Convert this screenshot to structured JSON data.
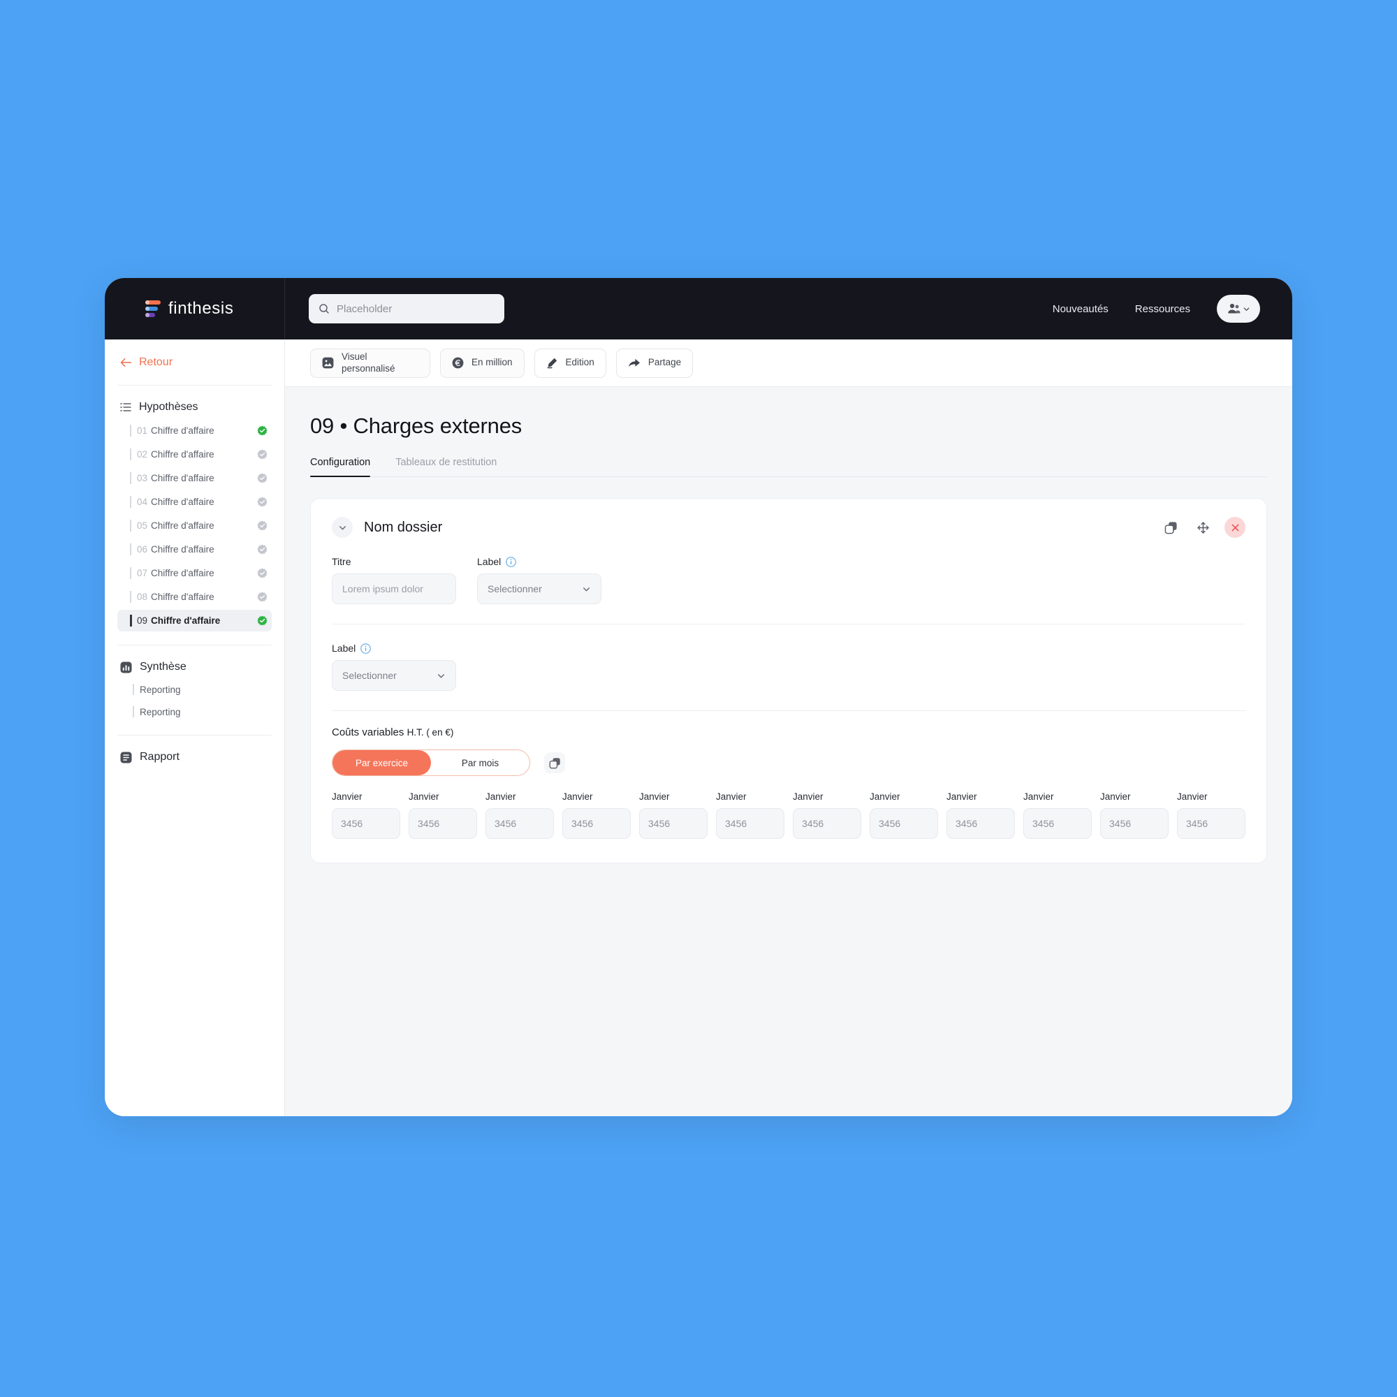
{
  "brand": {
    "name": "finthesis",
    "logo_colors": [
      "#f2714f",
      "#3f8fe0",
      "#6b3fb5"
    ]
  },
  "search": {
    "placeholder": "Placeholder",
    "icon": "search-icon"
  },
  "topnav": {
    "links": [
      {
        "label": "Nouveautés"
      },
      {
        "label": "Ressources"
      }
    ],
    "account": {
      "icon": "users-icon",
      "chevron": "chevron-down-icon"
    }
  },
  "sidebar": {
    "back": {
      "label": "Retour",
      "icon": "arrow-left-icon",
      "color": "#f2714f"
    },
    "sections": [
      {
        "title": "Hypothèses",
        "icon": "list-icon",
        "items": [
          {
            "num": "01",
            "label": "Chiffre d'affaire",
            "status": "done",
            "active": false
          },
          {
            "num": "02",
            "label": "Chiffre d'affaire",
            "status": "pending",
            "active": false
          },
          {
            "num": "03",
            "label": "Chiffre d'affaire",
            "status": "pending",
            "active": false
          },
          {
            "num": "04",
            "label": "Chiffre d'affaire",
            "status": "pending",
            "active": false
          },
          {
            "num": "05",
            "label": "Chiffre d'affaire",
            "status": "pending",
            "active": false
          },
          {
            "num": "06",
            "label": "Chiffre d'affaire",
            "status": "pending",
            "active": false
          },
          {
            "num": "07",
            "label": "Chiffre d'affaire",
            "status": "pending",
            "active": false
          },
          {
            "num": "08",
            "label": "Chiffre d'affaire",
            "status": "pending",
            "active": false
          },
          {
            "num": "09",
            "label": "Chiffre d'affaire",
            "status": "done",
            "active": true
          }
        ]
      },
      {
        "title": "Synthèse",
        "icon": "bar-chart-icon",
        "sub_items": [
          {
            "label": "Reporting"
          },
          {
            "label": "Reporting"
          }
        ]
      },
      {
        "title": "Rapport",
        "icon": "document-icon",
        "sub_items": []
      }
    ],
    "status_colors": {
      "done": "#2fb344",
      "pending": "#c3c6cc"
    }
  },
  "toolbar": {
    "buttons": [
      {
        "label": "Visuel personnalisé",
        "icon": "image-icon",
        "multiline": true
      },
      {
        "label": "En million",
        "icon": "euro-coin-icon",
        "multiline": true
      },
      {
        "label": "Edition",
        "icon": "pencil-icon",
        "multiline": false
      },
      {
        "label": "Partage",
        "icon": "share-arrow-icon",
        "multiline": false
      }
    ]
  },
  "main": {
    "title": "09 • Charges externes",
    "tabs": [
      {
        "label": "Configuration",
        "active": true
      },
      {
        "label": "Tableaux de restitution",
        "active": false
      }
    ],
    "card": {
      "title": "Nom dossier",
      "collapse_icon": "chevron-down-icon",
      "actions": [
        {
          "name": "duplicate",
          "icon": "copy-icon"
        },
        {
          "name": "move",
          "icon": "move-icon"
        },
        {
          "name": "delete",
          "icon": "close-icon",
          "color": "#e8595b"
        }
      ],
      "fields": [
        {
          "label": "Titre",
          "type": "text",
          "value": "",
          "placeholder": "Lorem ipsum dolor",
          "info": false
        },
        {
          "label": "Label",
          "type": "select",
          "value": "Selectionner",
          "info": true
        }
      ],
      "field_label_2": "Label",
      "field_select_2": "Selectionner",
      "cost_section": {
        "title_main": "Coûts variables ",
        "title_small": "H.T. ( en €)",
        "toggle": [
          {
            "label": "Par exercice",
            "active": true
          },
          {
            "label": "Par mois",
            "active": false
          }
        ],
        "copy_icon": "copy-icon",
        "months": [
          {
            "name": "Janvier",
            "value": "3456"
          },
          {
            "name": "Janvier",
            "value": "3456"
          },
          {
            "name": "Janvier",
            "value": "3456"
          },
          {
            "name": "Janvier",
            "value": "3456"
          },
          {
            "name": "Janvier",
            "value": "3456"
          },
          {
            "name": "Janvier",
            "value": "3456"
          },
          {
            "name": "Janvier",
            "value": "3456"
          },
          {
            "name": "Janvier",
            "value": "3456"
          },
          {
            "name": "Janvier",
            "value": "3456"
          },
          {
            "name": "Janvier",
            "value": "3456"
          },
          {
            "name": "Janvier",
            "value": "3456"
          },
          {
            "name": "Janvier",
            "value": "3456"
          }
        ]
      }
    }
  },
  "theme": {
    "page_background": "#4da2f5",
    "topbar_background": "#15161d",
    "accent": "#f5755a",
    "content_background": "#f5f6f8"
  }
}
